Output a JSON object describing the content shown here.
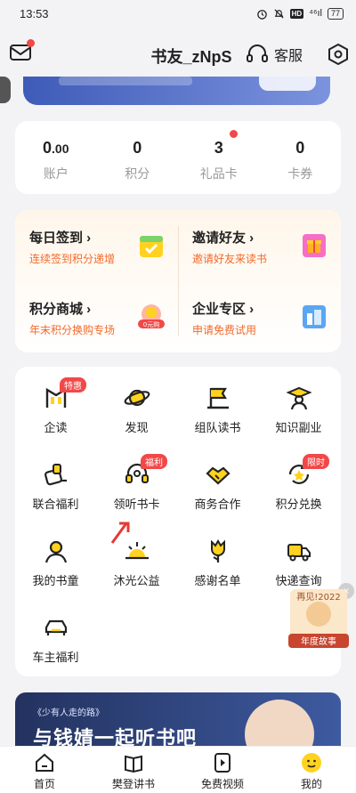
{
  "status_bar": {
    "time": "13:53",
    "signal": "⁴⁶ıl",
    "battery": "77"
  },
  "header": {
    "username": "书友_zNpS",
    "service_label": "客服"
  },
  "stats": [
    {
      "value": "0",
      "decimals": ".00",
      "label": "账户"
    },
    {
      "value": "0",
      "label": "积分"
    },
    {
      "value": "3",
      "label": "礼品卡"
    },
    {
      "value": "0",
      "label": "卡券"
    }
  ],
  "tasks": [
    {
      "title": "每日签到",
      "subtitle": "连续签到积分递增"
    },
    {
      "title": "邀请好友",
      "subtitle": "邀请好友来读书"
    },
    {
      "title": "积分商城",
      "subtitle": "年末积分换购专场",
      "badge": "0元购"
    },
    {
      "title": "企业专区",
      "subtitle": "申请免费试用"
    }
  ],
  "grid": [
    {
      "label": "企读",
      "icon": "company-read-icon",
      "tag": "特惠"
    },
    {
      "label": "发现",
      "icon": "planet-icon"
    },
    {
      "label": "组队读书",
      "icon": "flag-book-icon"
    },
    {
      "label": "知识副业",
      "icon": "graduate-icon"
    },
    {
      "label": "联合福利",
      "icon": "gift-tag-icon"
    },
    {
      "label": "领听书卡",
      "icon": "headphones-icon",
      "tag": "福利"
    },
    {
      "label": "商务合作",
      "icon": "handshake-icon"
    },
    {
      "label": "积分兑换",
      "icon": "exchange-icon",
      "tag": "限时"
    },
    {
      "label": "我的书童",
      "icon": "user-icon"
    },
    {
      "label": "沐光公益",
      "icon": "sunrise-icon"
    },
    {
      "label": "感谢名单",
      "icon": "flower-icon"
    },
    {
      "label": "快递查询",
      "icon": "truck-icon"
    },
    {
      "label": "车主福利",
      "icon": "car-icon"
    }
  ],
  "floating_ad": {
    "year": "再见!2022",
    "label": "年度故事"
  },
  "promo": {
    "subtitle": "《少有人走的路》",
    "title": "与钱婧一起听书吧"
  },
  "tabs": [
    {
      "label": "首页",
      "icon": "home-icon"
    },
    {
      "label": "樊登讲书",
      "icon": "book-icon"
    },
    {
      "label": "免费视频",
      "icon": "video-icon"
    },
    {
      "label": "我的",
      "icon": "profile-face-icon"
    }
  ],
  "colors": {
    "accent": "#f24848",
    "orange_text": "#f26a2a",
    "promo_bg": "#2b3c73",
    "active_tab": "#ffd21f"
  }
}
